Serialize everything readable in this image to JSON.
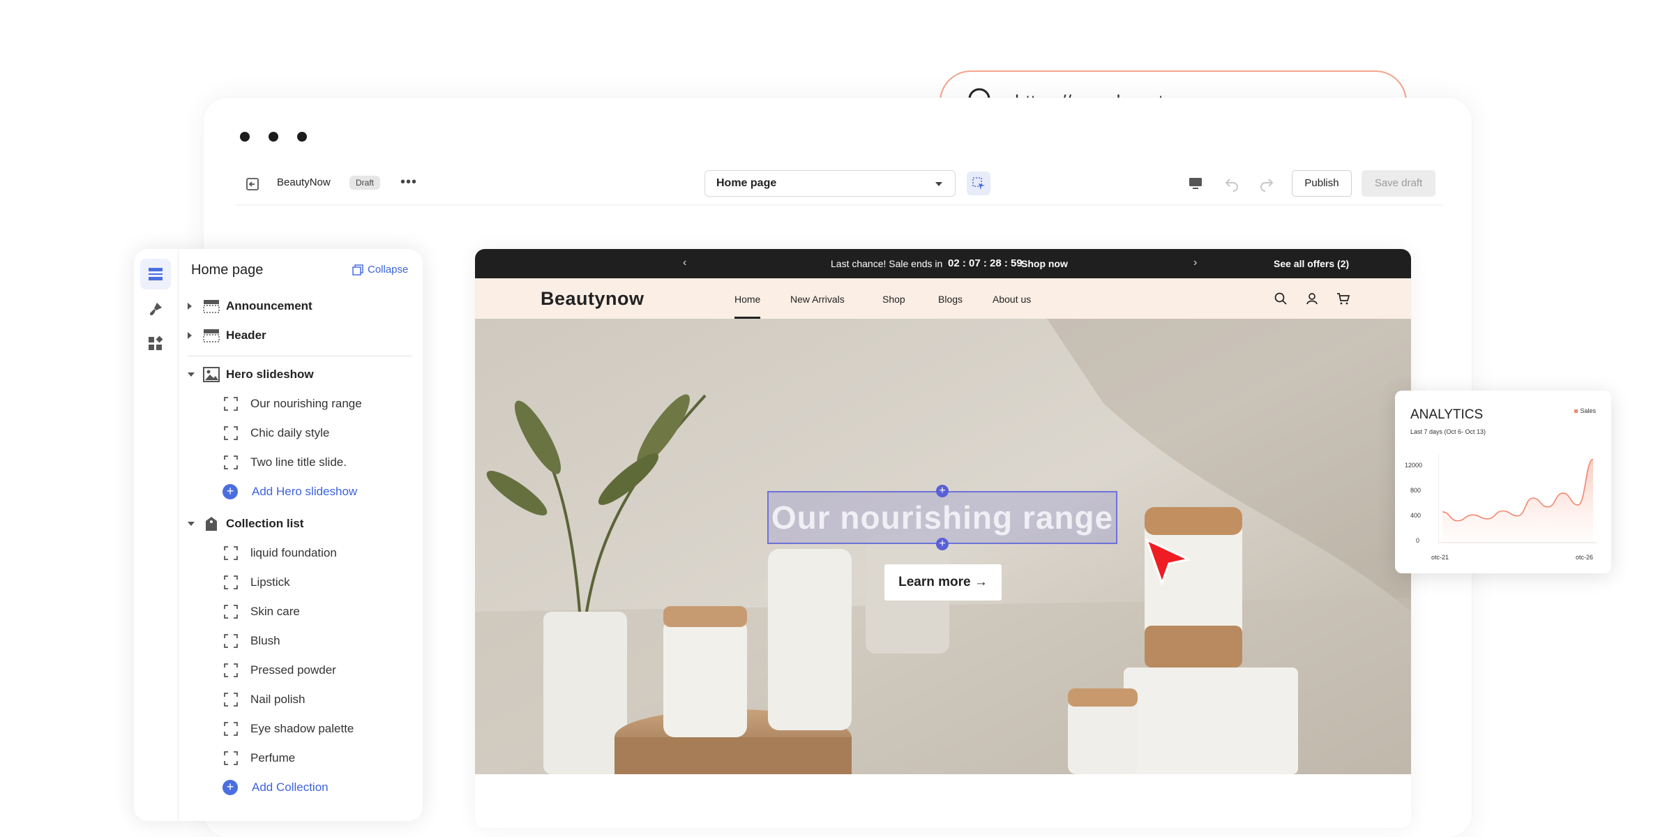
{
  "browser": {
    "url": "https://www.beautynow..."
  },
  "editor": {
    "store_name": "BeautyNow",
    "status_badge": "Draft",
    "more_label": "•••",
    "page_select": "Home page",
    "publish_label": "Publish",
    "save_draft_label": "Save draft"
  },
  "sidebar": {
    "title": "Home page",
    "collapse_label": "Collapse",
    "sections": [
      {
        "label": "Announcement"
      },
      {
        "label": "Header"
      }
    ],
    "hero": {
      "label": "Hero slideshow",
      "children": [
        "Our nourishing range",
        "Chic daily style",
        "Two line title slide."
      ],
      "add_label": "Add Hero slideshow"
    },
    "collection": {
      "label": "Collection list",
      "children": [
        "liquid foundation",
        "Lipstick",
        "Skin care",
        "Blush",
        "Pressed powder",
        "Nail polish",
        "Eye shadow palette",
        "Perfume"
      ],
      "add_label": "Add Collection"
    }
  },
  "store": {
    "announcement": {
      "message": "Last chance! Sale ends in",
      "timer": "02 : 07 : 28 : 59",
      "shop_now": "Shop now",
      "offers": "See  all offers (2)"
    },
    "logo": "Beautynow",
    "nav": [
      "Home",
      "New Arrivals",
      "Shop",
      "Blogs",
      "About us"
    ],
    "hero": {
      "title": "Our nourishing range",
      "button": "Learn more →"
    }
  },
  "analytics": {
    "title": "ANALYTICS",
    "subtitle": "Last 7 days (Oct 6- Oct 13)",
    "legend": "Sales",
    "accent": "#f08870"
  },
  "chart_data": {
    "type": "area",
    "series": [
      {
        "name": "Sales",
        "values": [
          620,
          440,
          560,
          480,
          640,
          540,
          900,
          720,
          1000,
          760,
          1680
        ]
      }
    ],
    "y_ticks": [
      "12000",
      "800",
      "400",
      "0"
    ],
    "x_ticks": [
      "otc-21",
      "otc-26"
    ],
    "ylim": [
      0,
      1800
    ],
    "grid": false
  }
}
